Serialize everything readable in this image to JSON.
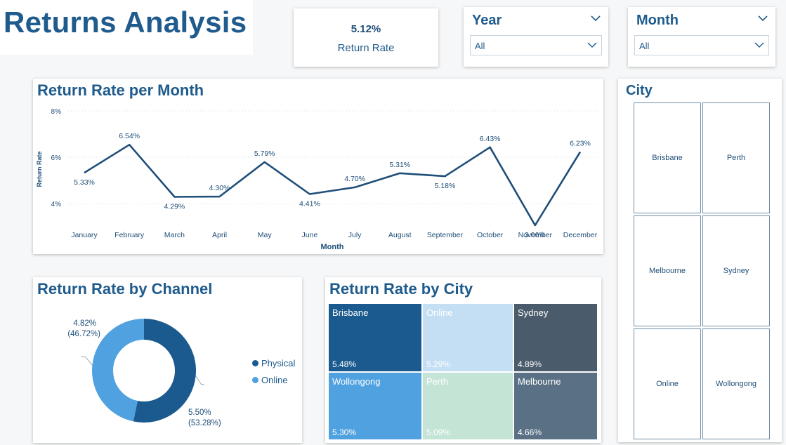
{
  "page_title": "Returns Analysis",
  "kpi": {
    "value": "5.12%",
    "label": "Return Rate"
  },
  "slicers": {
    "year": {
      "title": "Year",
      "selected": "All"
    },
    "month": {
      "title": "Month",
      "selected": "All"
    },
    "city": {
      "title": "City",
      "options": [
        "Brisbane",
        "Perth",
        "Melbourne",
        "Sydney",
        "Online",
        "Wollongong"
      ]
    }
  },
  "colors": {
    "line": "#1f4e79",
    "physical": "#1a5a8e",
    "online": "#4fa1e0"
  },
  "chart_data": [
    {
      "type": "line",
      "title": "Return Rate per Month",
      "xlabel": "Month",
      "ylabel": "Return Rate",
      "categories": [
        "January",
        "February",
        "March",
        "April",
        "May",
        "June",
        "July",
        "August",
        "September",
        "October",
        "November",
        "December"
      ],
      "values": [
        5.33,
        6.54,
        4.29,
        4.3,
        5.79,
        4.41,
        4.7,
        5.31,
        5.18,
        6.43,
        3.06,
        6.23
      ],
      "data_labels": [
        "5.33%",
        "6.54%",
        "4.29%",
        "4.30%",
        "5.79%",
        "4.41%",
        "4.70%",
        "5.31%",
        "5.18%",
        "6.43%",
        "3.06%",
        "6.23%"
      ],
      "yticks": [
        "4%",
        "6%",
        "8%"
      ],
      "ytick_values": [
        4,
        6,
        8
      ],
      "ylim": [
        3,
        8
      ],
      "grid": true
    },
    {
      "type": "pie",
      "title": "Return Rate by Channel",
      "categories": [
        "Physical",
        "Online"
      ],
      "values": [
        5.5,
        4.82
      ],
      "shares": [
        53.28,
        46.72
      ],
      "data_labels": [
        {
          "value": "5.50%",
          "share": "(53.28%)"
        },
        {
          "value": "4.82%",
          "share": "(46.72%)"
        }
      ],
      "legend": "right"
    },
    {
      "type": "heatmap",
      "title": "Return Rate by City",
      "categories": [
        "Brisbane",
        "Online",
        "Sydney",
        "Wollongong",
        "Perth",
        "Melbourne"
      ],
      "values": [
        5.48,
        5.29,
        4.89,
        5.3,
        5.09,
        4.66
      ],
      "data_labels": [
        "5.48%",
        "5.29%",
        "4.89%",
        "5.30%",
        "5.09%",
        "4.66%"
      ],
      "tile_colors": [
        "#1a5a8e",
        "#c4dff4",
        "#4a5c6b",
        "#4fa1e0",
        "#c4e4d6",
        "#5a7185"
      ]
    }
  ]
}
